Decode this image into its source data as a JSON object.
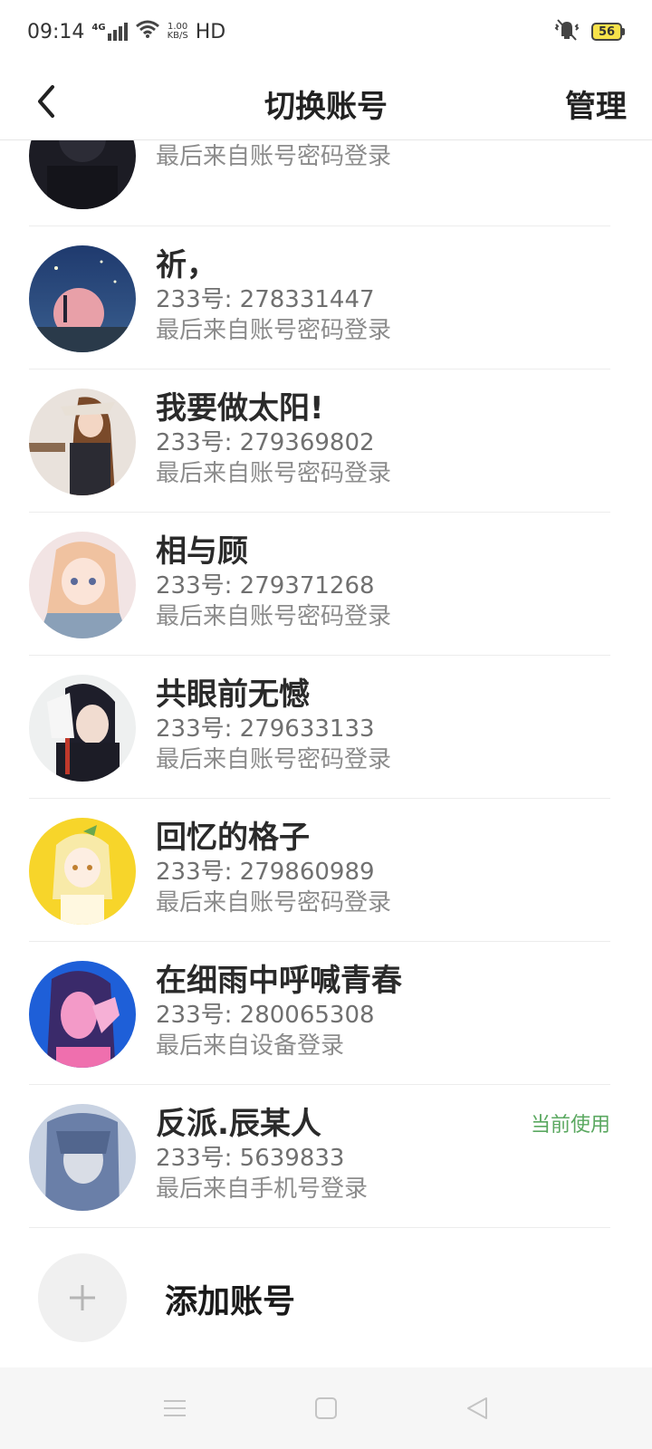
{
  "status_bar": {
    "time": "09:14",
    "network_type": "4G",
    "speed_value": "1.00",
    "speed_unit": "KB/S",
    "hd_label": "HD",
    "battery_level": "56",
    "icons": [
      "signal-icon",
      "wifi-icon",
      "mute-vibrate-icon",
      "battery-icon"
    ]
  },
  "header": {
    "title": "切换账号",
    "manage_label": "管理",
    "back_icon": "chevron-left-icon"
  },
  "accounts": [
    {
      "name": "",
      "id_text": "",
      "login_text": "最后来自账号密码登录",
      "current": false
    },
    {
      "name": "祈，",
      "id_text": "233号: 278331447",
      "login_text": "最后来自账号密码登录",
      "current": false
    },
    {
      "name": "我要做太阳!",
      "id_text": "233号: 279369802",
      "login_text": "最后来自账号密码登录",
      "current": false
    },
    {
      "name": "相与顾",
      "id_text": "233号: 279371268",
      "login_text": "最后来自账号密码登录",
      "current": false
    },
    {
      "name": "共眼前无憾",
      "id_text": "233号: 279633133",
      "login_text": "最后来自账号密码登录",
      "current": false
    },
    {
      "name": "回忆的格子",
      "id_text": "233号: 279860989",
      "login_text": "最后来自账号密码登录",
      "current": false
    },
    {
      "name": "在细雨中呼喊青春",
      "id_text": "233号: 280065308",
      "login_text": "最后来自设备登录",
      "current": false
    },
    {
      "name": "反派.辰某人",
      "id_text": "233号: 5639833",
      "login_text": "最后来自手机号登录",
      "current": true,
      "current_label": "当前使用"
    }
  ],
  "add_account": {
    "label": "添加账号",
    "icon": "plus-icon"
  },
  "bottom_nav": {
    "icons": [
      "menu-icon",
      "home-square-icon",
      "back-triangle-icon"
    ]
  },
  "colors": {
    "current_badge": "#5aa860",
    "divider": "#ececec"
  }
}
